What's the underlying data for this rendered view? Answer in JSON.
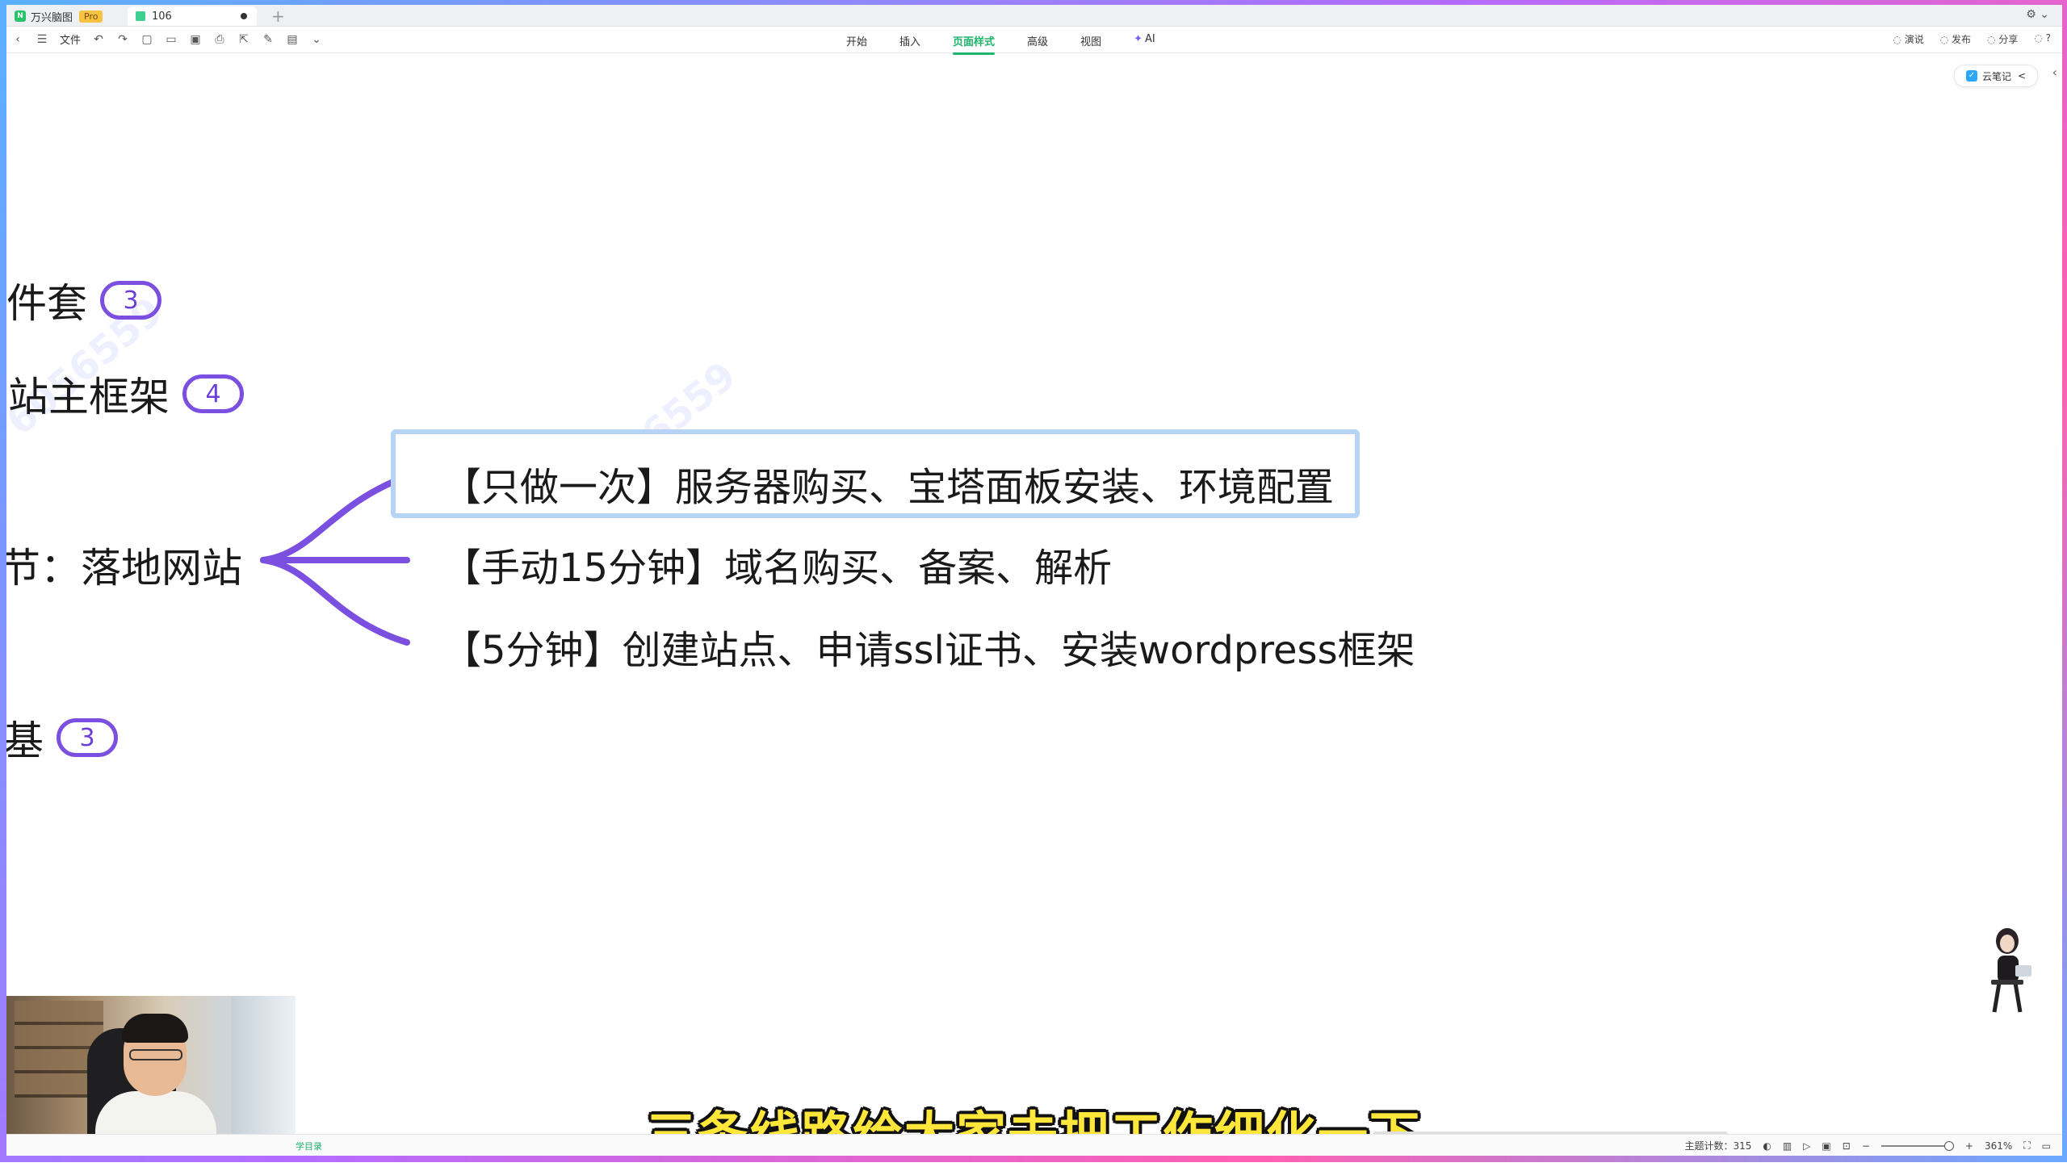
{
  "titlebar": {
    "app_name": "万兴脑图",
    "app_badge": "Pro",
    "doc_tab": "106",
    "new_tab": "+",
    "user_menu": "⚙ ⌄"
  },
  "toolbar": {
    "file_label": "文件",
    "tabs": [
      "开始",
      "插入",
      "页面样式",
      "高级",
      "视图",
      "AI"
    ],
    "active_tab": "页面样式",
    "right_actions": [
      "演说",
      "发布",
      "分享",
      "?"
    ]
  },
  "side_panel": {
    "cloud_label": "云笔记",
    "collapse": "<"
  },
  "mindmap": {
    "side_nodes": [
      {
        "text": "件套",
        "count": "3"
      },
      {
        "text": "站主框架",
        "count": "4"
      },
      {
        "text": "节：落地网站",
        "count": ""
      },
      {
        "text": "基",
        "count": "3"
      }
    ],
    "children": [
      "【只做一次】服务器购买、宝塔面板安装、环境配置",
      "【手动15分钟】域名购买、备案、解析",
      "【5分钟】创建站点、申请ssl证书、安装wordpress框架"
    ],
    "branch_color": "#7b4fe0",
    "watermark": "6056559"
  },
  "subtitle": "三条线路给大家去把工作细化一下",
  "statusbar": {
    "left_text": "学目录",
    "topic_count": "主题计数：315",
    "zoom": "361%"
  }
}
